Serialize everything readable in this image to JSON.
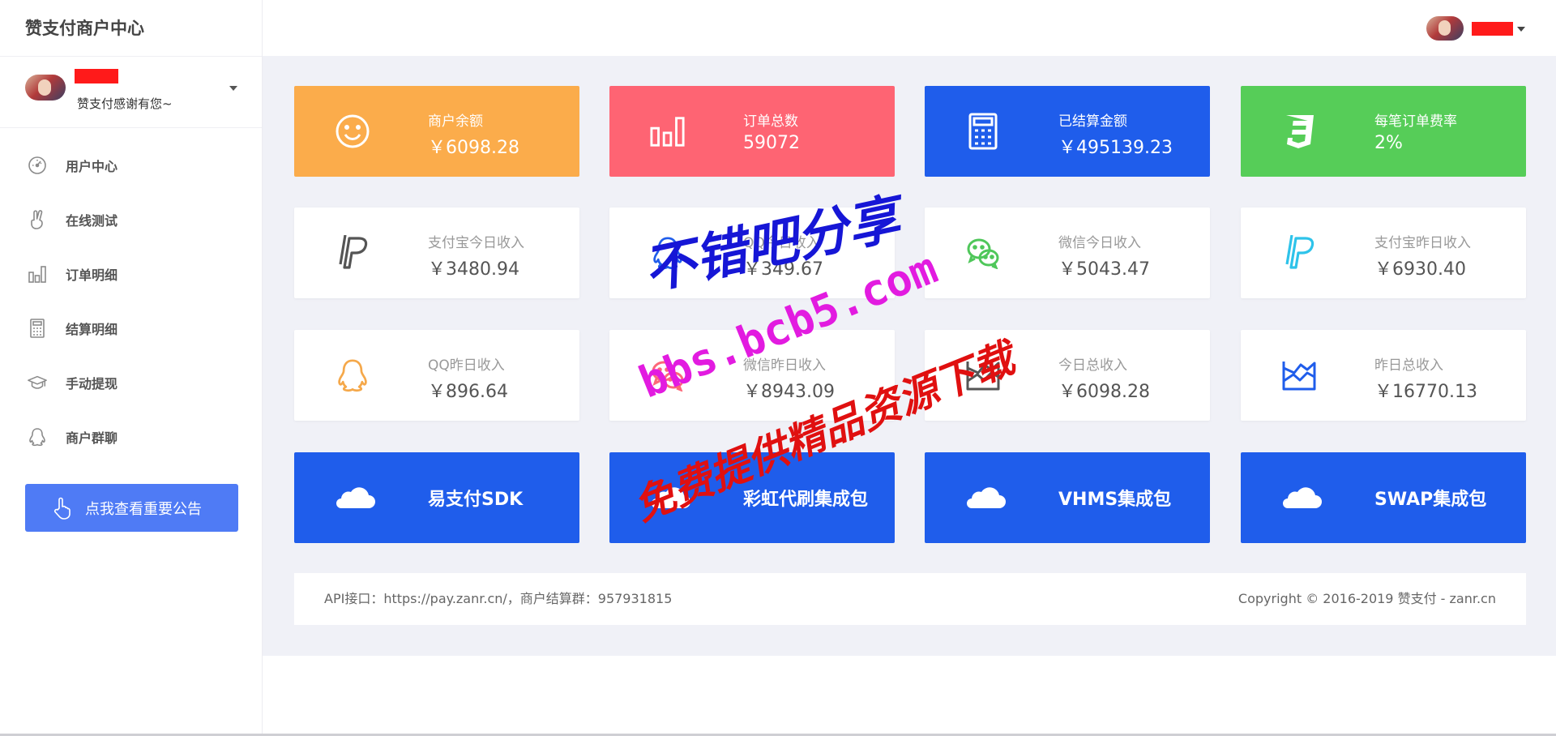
{
  "sidebar": {
    "brand": "赞支付商户中心",
    "user_greeting": "赞支付感谢有您~",
    "nav": [
      {
        "label": "用户中心",
        "icon": "dashboard-icon"
      },
      {
        "label": "在线测试",
        "icon": "hand-peace-icon"
      },
      {
        "label": "订单明细",
        "icon": "bar-chart-icon"
      },
      {
        "label": "结算明细",
        "icon": "calculator-icon"
      },
      {
        "label": "手动提现",
        "icon": "graduation-cap-icon"
      },
      {
        "label": "商户群聊",
        "icon": "qq-icon"
      }
    ],
    "notice_button": "点我查看重要公告"
  },
  "stats": [
    {
      "label": "商户余额",
      "value": "￥6098.28",
      "icon": "smile-icon",
      "color": "#fbac4b"
    },
    {
      "label": "订单总数",
      "value": "59072",
      "icon": "bar-chart-icon",
      "color": "#fe6473"
    },
    {
      "label": "已结算金额",
      "value": "￥495139.23",
      "icon": "calculator-icon",
      "color": "#1f5deb"
    },
    {
      "label": "每笔订单费率",
      "value": "2%",
      "icon": "css3-icon",
      "color": "#56cd58"
    }
  ],
  "income": [
    {
      "label": "支付宝今日收入",
      "value": "￥3480.94",
      "icon": "paypal-icon",
      "icon_color": "#555555"
    },
    {
      "label": "QQ今日收入",
      "value": "￥349.67",
      "icon": "qq-icon",
      "icon_color": "#1f5deb"
    },
    {
      "label": "微信今日收入",
      "value": "￥5043.47",
      "icon": "wechat-icon",
      "icon_color": "#4fc75a"
    },
    {
      "label": "支付宝昨日收入",
      "value": "￥6930.40",
      "icon": "paypal-icon",
      "icon_color": "#2ec3ea"
    },
    {
      "label": "QQ昨日收入",
      "value": "￥896.64",
      "icon": "qq-icon",
      "icon_color": "#f5a84a"
    },
    {
      "label": "微信昨日收入",
      "value": "￥8943.09",
      "icon": "wechat-icon",
      "icon_color": "#fd6878"
    },
    {
      "label": "今日总收入",
      "value": "￥6098.28",
      "icon": "area-chart-icon",
      "icon_color": "#555555"
    },
    {
      "label": "昨日总收入",
      "value": "￥16770.13",
      "icon": "area-chart-icon",
      "icon_color": "#1f5deb"
    }
  ],
  "downloads": [
    {
      "label": "易支付SDK"
    },
    {
      "label": "彩虹代刷集成包"
    },
    {
      "label": "VHMS集成包"
    },
    {
      "label": "SWAP集成包"
    }
  ],
  "download_color": "#1f5deb",
  "footer": {
    "left": "API接口：https://pay.zanr.cn/，商户结算群：957931815",
    "right": "Copyright © 2016-2019 赞支付 - zanr.cn"
  },
  "watermark": {
    "line1": "不错吧分享",
    "line2": "bbs.bcb5.com",
    "line3": "免费提供精品资源下载"
  }
}
